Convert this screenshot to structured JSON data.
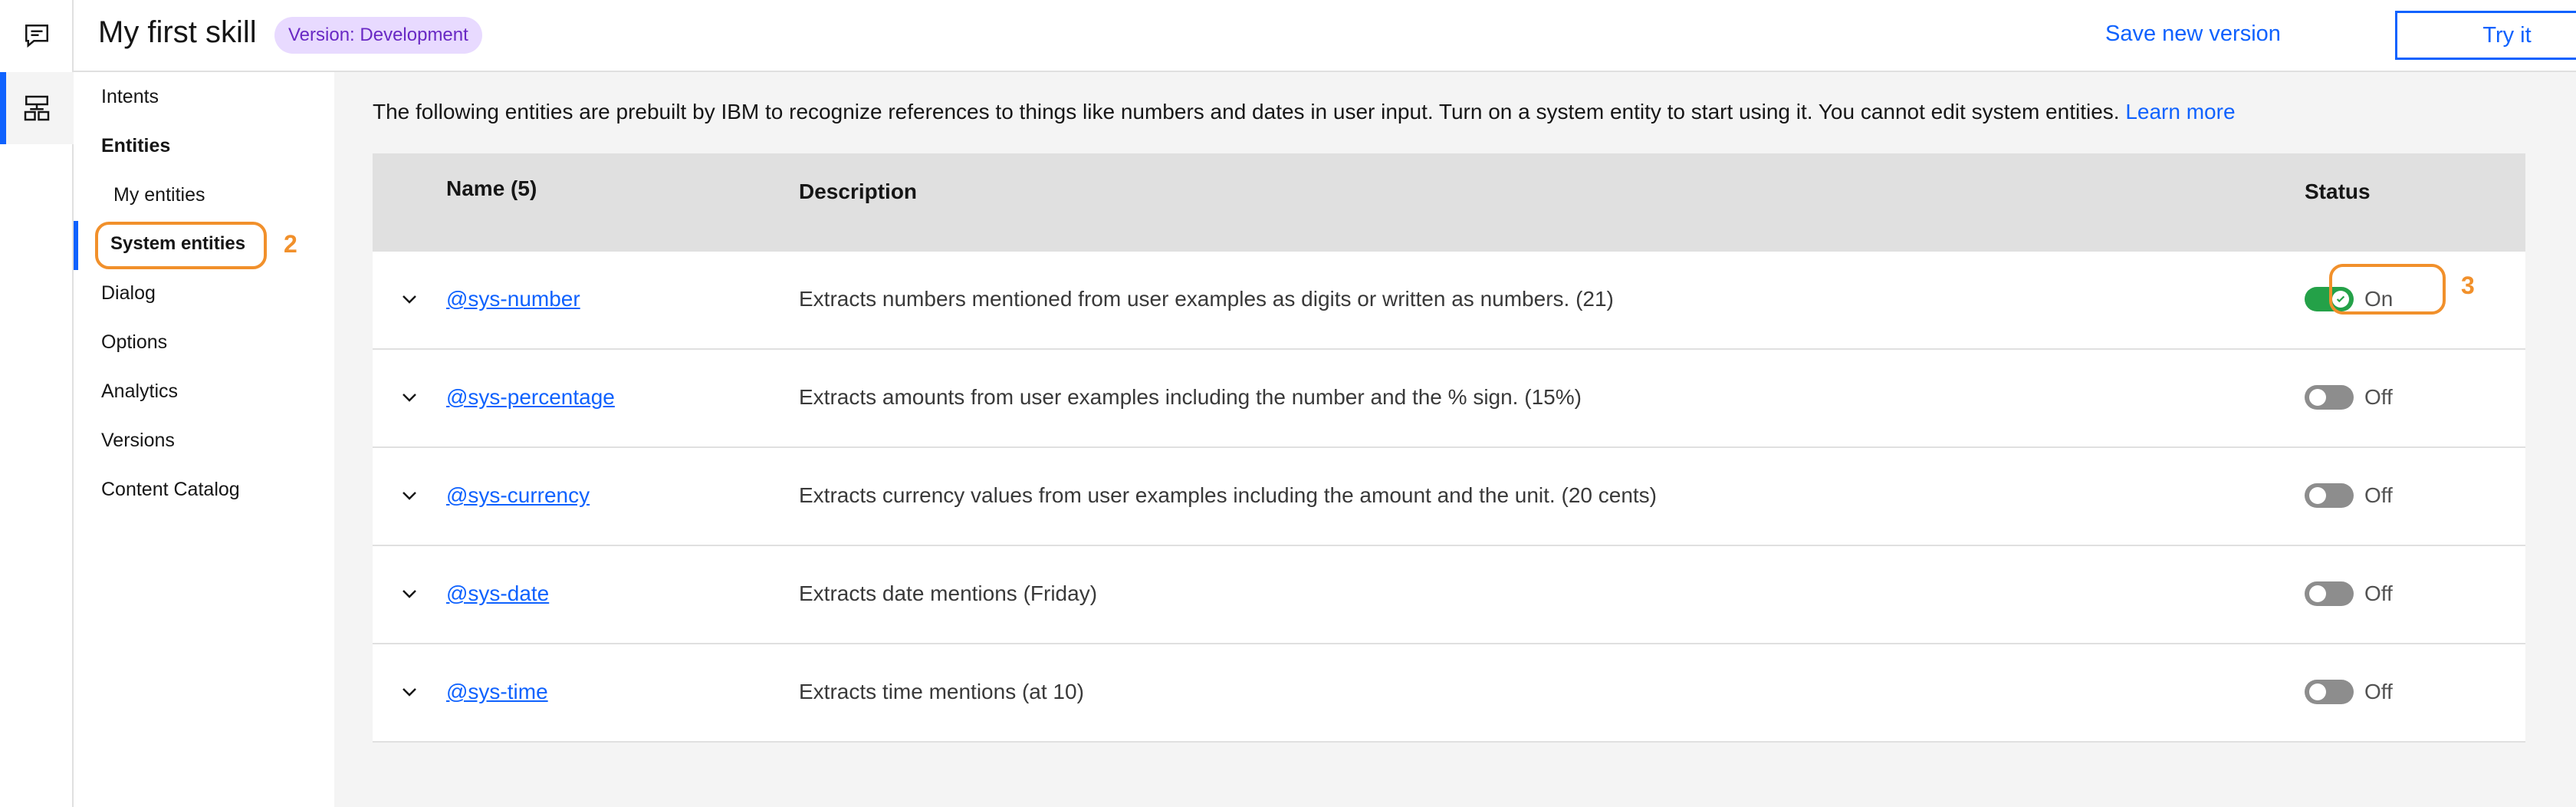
{
  "header": {
    "title": "My first skill",
    "version_tag": "Version: Development",
    "save_label": "Save new version",
    "try_label": "Try it"
  },
  "rail": {
    "icons": [
      "chat-icon",
      "skills-icon"
    ]
  },
  "nav": {
    "items": [
      {
        "label": "Intents"
      },
      {
        "label": "Entities"
      },
      {
        "label": "My entities"
      },
      {
        "label": "System entities"
      },
      {
        "label": "Dialog"
      },
      {
        "label": "Options"
      },
      {
        "label": "Analytics"
      },
      {
        "label": "Versions"
      },
      {
        "label": "Content Catalog"
      }
    ],
    "active": "System entities"
  },
  "callouts": {
    "nav": "2",
    "status": "3"
  },
  "main": {
    "intro": "The following entities are prebuilt by IBM to recognize references to things like numbers and dates in user input. Turn on a system entity to start using it. You cannot edit system entities.",
    "learn_more": "Learn more"
  },
  "table": {
    "headers": {
      "name": "Name (5)",
      "description": "Description",
      "status": "Status"
    },
    "rows": [
      {
        "name": "@sys-number",
        "description": "Extracts numbers mentioned from user examples as digits or written as numbers. (21)",
        "status": "On",
        "enabled": true
      },
      {
        "name": "@sys-percentage",
        "description": "Extracts amounts from user examples including the number and the % sign. (15%)",
        "status": "Off",
        "enabled": false
      },
      {
        "name": "@sys-currency",
        "description": "Extracts currency values from user examples including the amount and the unit. (20 cents)",
        "status": "Off",
        "enabled": false
      },
      {
        "name": "@sys-date",
        "description": "Extracts date mentions (Friday)",
        "status": "Off",
        "enabled": false
      },
      {
        "name": "@sys-time",
        "description": "Extracts time mentions (at 10)",
        "status": "Off",
        "enabled": false
      }
    ]
  },
  "colors": {
    "accent": "#0f62fe",
    "callout": "#f1902b",
    "toggle_on": "#24a148",
    "toggle_off": "#8d8d8d"
  }
}
